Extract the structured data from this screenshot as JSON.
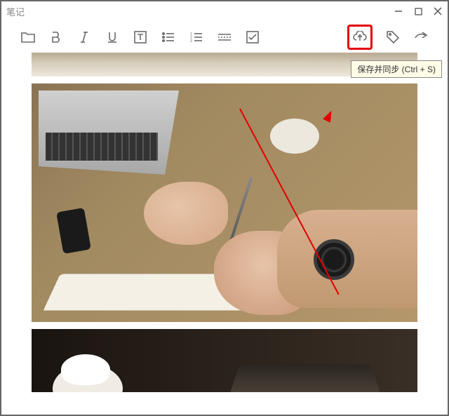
{
  "window": {
    "title": "笔记"
  },
  "toolbar": {
    "tooltip_save_sync": "保存并同步 (Ctrl + S)"
  },
  "annotation": {
    "highlight_target": "cloud-sync-button"
  }
}
